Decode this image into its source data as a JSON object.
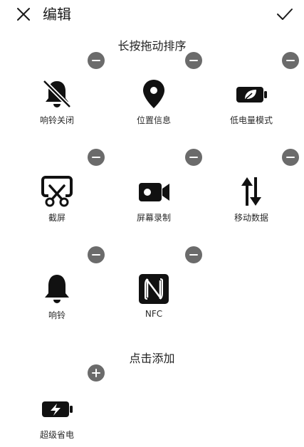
{
  "header": {
    "title": "编辑",
    "close_icon": "close-icon",
    "confirm_icon": "checkmark-icon"
  },
  "sections": {
    "drag_hint": "长按拖动排序",
    "add_hint": "点击添加"
  },
  "active_tiles": [
    {
      "label": "响铃关闭",
      "icon": "bell-off-icon"
    },
    {
      "label": "位置信息",
      "icon": "location-pin-icon"
    },
    {
      "label": "低电量模式",
      "icon": "battery-leaf-icon"
    },
    {
      "label": "截屏",
      "icon": "screenshot-scissors-icon"
    },
    {
      "label": "屏幕录制",
      "icon": "video-camera-icon"
    },
    {
      "label": "移动数据",
      "icon": "up-down-arrows-icon"
    },
    {
      "label": "响铃",
      "icon": "bell-icon"
    },
    {
      "label": "NFC",
      "icon": "nfc-icon"
    }
  ],
  "available_tiles": [
    {
      "label": "超级省电",
      "icon": "battery-bolt-icon"
    }
  ],
  "colors": {
    "badge": "#6b6b6b",
    "icon": "#111111",
    "background": "#ffffff"
  }
}
